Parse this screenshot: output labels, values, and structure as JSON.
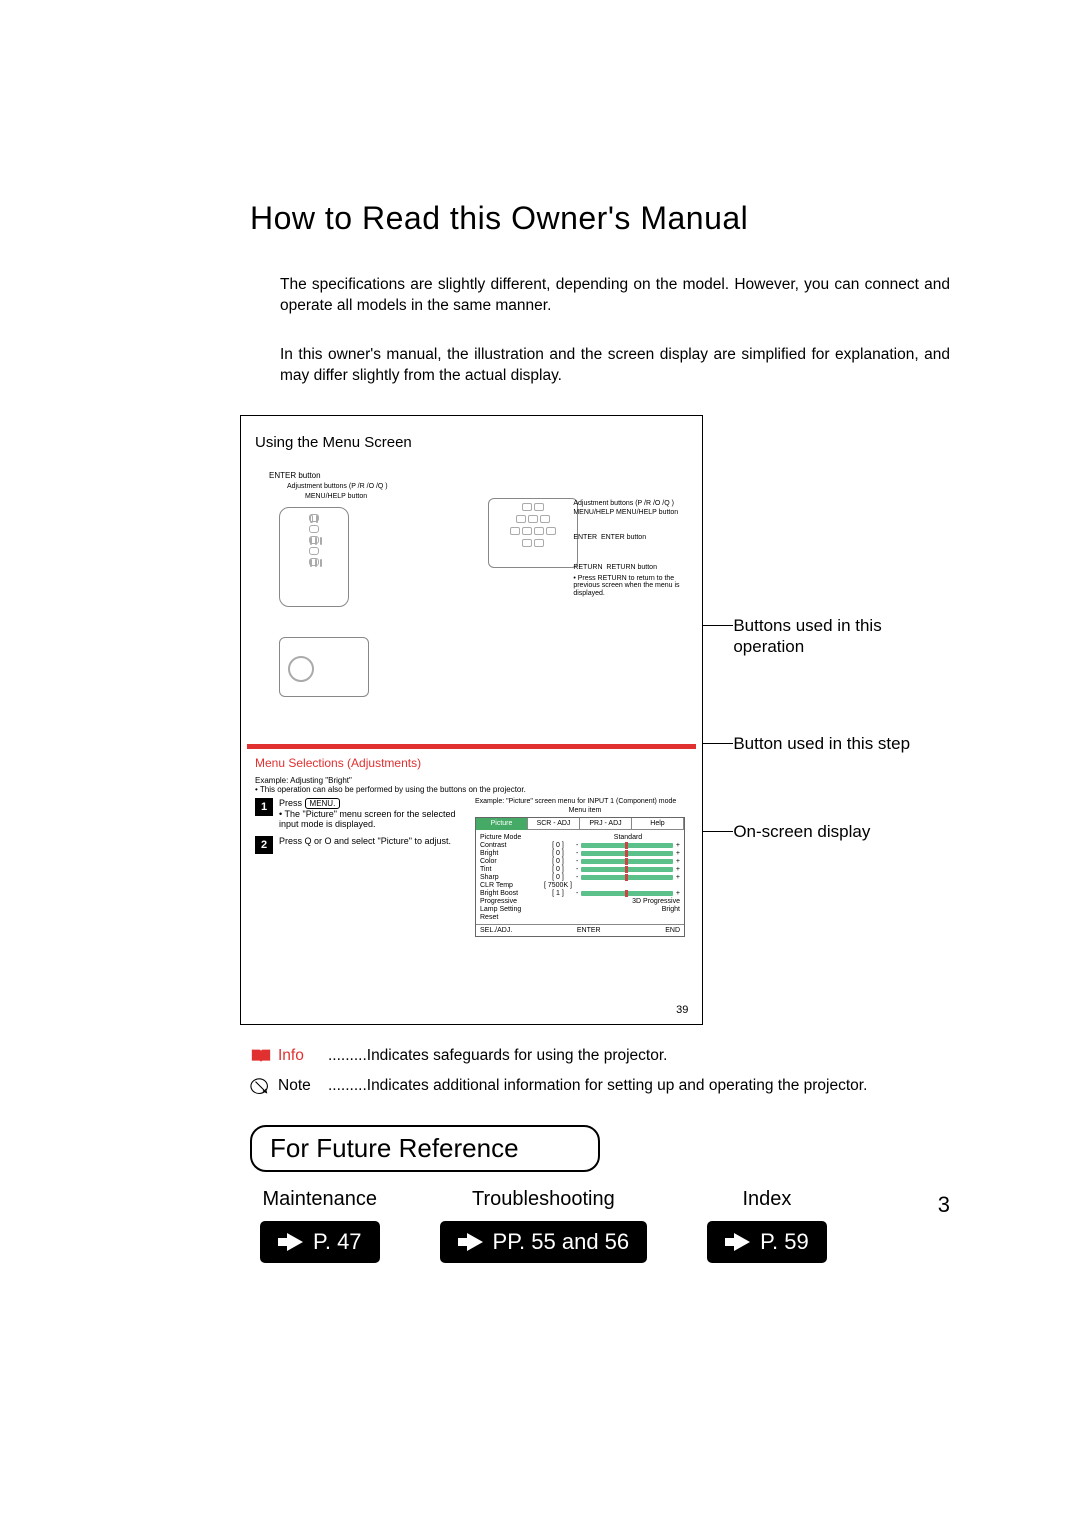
{
  "title": "How to Read this Owner's Manual",
  "intro1": "The specifications are slightly different, depending on the model. However, you can connect and operate all models in the same manner.",
  "intro2": "In this owner's manual, the illustration and the screen display are simplified for explanation, and may differ slightly from the actual display.",
  "illustration": {
    "title": "Using the Menu Screen",
    "enter_btn": "ENTER button",
    "adj_btns": "Adjustment buttons (P /R /O /Q )",
    "menuhelp_btn": "MENU/HELP button",
    "proj_adj": "Adjustment buttons (P /R /O /Q )",
    "proj_menuhelp": "MENU/HELP button",
    "proj_menuhelp_sub": "MENU/HELP",
    "proj_enter": "ENTER button",
    "proj_enter_sub": "ENTER",
    "proj_return": "RETURN button",
    "proj_return_sub": "RETURN",
    "proj_return_note": "• Press RETURN to return to the previous screen when the menu is displayed.",
    "red_heading": "Menu Selections (Adjustments)",
    "example_line": "Example: Adjusting \"Bright\"",
    "example_sub": "• This operation can also be performed by using the buttons on the projector.",
    "step1_pre": "Press",
    "step1_btn": "MENU.",
    "step1_post": "• The \"Picture\" menu screen for the selected input mode is displayed.",
    "step2": "Press Q or O and select \"Picture\" to adjust.",
    "osd_example_title": "Example: \"Picture\" screen menu for INPUT 1 (Component) mode",
    "osd_menu_item": "Menu item",
    "osd_tabs": [
      "Picture",
      "SCR - ADJ",
      "PRJ - ADJ",
      "Help"
    ],
    "osd_rows": [
      {
        "lab": "Picture Mode",
        "val": "",
        "right": "Standard"
      },
      {
        "lab": "Contrast",
        "val": "[   0 ]"
      },
      {
        "lab": "Bright",
        "val": "[   0 ]"
      },
      {
        "lab": "Color",
        "val": "[   0 ]"
      },
      {
        "lab": "Tint",
        "val": "[   0 ]"
      },
      {
        "lab": "Sharp",
        "val": "[   0 ]"
      },
      {
        "lab": "CLR Temp",
        "val": "[ 7500K ]"
      },
      {
        "lab": "Bright Boost",
        "val": "[   1 ]"
      },
      {
        "lab": "Progressive",
        "val": "",
        "right": "3D Progressive"
      },
      {
        "lab": "Lamp Setting",
        "val": "",
        "right": "Bright"
      },
      {
        "lab": "Reset",
        "val": ""
      }
    ],
    "osd_foot": [
      "SEL./ADJ.",
      "ENTER",
      "END"
    ],
    "inner_page": "39"
  },
  "callouts": {
    "c1": "Buttons used in this operation",
    "c2": "Button used in this step",
    "c3": "On-screen display"
  },
  "legend": {
    "info_label": "Info",
    "info_text": ".........Indicates safeguards for using the projector.",
    "note_label": "Note",
    "note_text": ".........Indicates additional information for setting up and operating the projector."
  },
  "future": {
    "heading": "For Future Reference",
    "maintenance": "Maintenance",
    "maintenance_page": "P. 47",
    "troubleshooting": "Troubleshooting",
    "troubleshooting_page": "PP. 55 and 56",
    "index": "Index",
    "index_page": "P. 59"
  },
  "page_number": "3"
}
